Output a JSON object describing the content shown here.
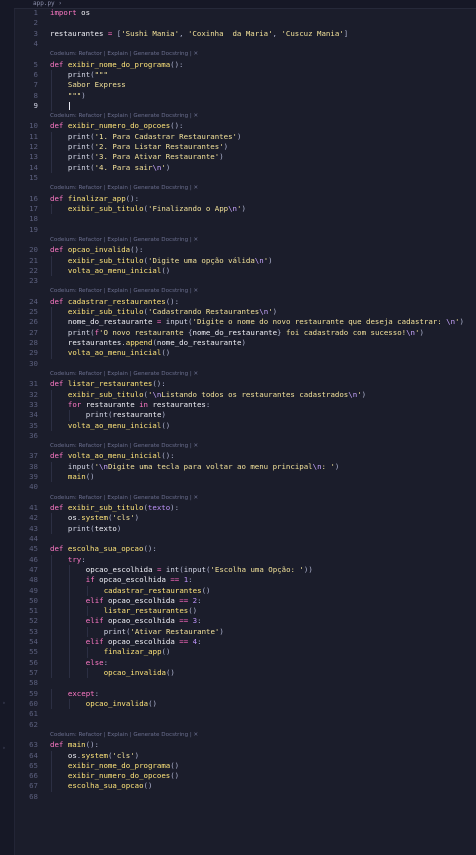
{
  "tab": {
    "filename": "app.py",
    "marker": "›"
  },
  "lens_text": "Codeium: Refactor | Explain | Generate Docstring | ✕",
  "lines": [
    {
      "n": "1",
      "indent": 0,
      "t": [
        [
          "k",
          "import"
        ],
        [
          "p",
          " "
        ],
        [
          "v",
          "os"
        ]
      ]
    },
    {
      "n": "2",
      "indent": 0,
      "t": []
    },
    {
      "n": "3",
      "indent": 0,
      "t": [
        [
          "v",
          "restaurantes"
        ],
        [
          "op",
          " = "
        ],
        [
          "p",
          "["
        ],
        [
          "s",
          "'Sushi Mania'"
        ],
        [
          "p",
          ", "
        ],
        [
          "s",
          "'Coxinha  da Maria'"
        ],
        [
          "p",
          ", "
        ],
        [
          "s",
          "'Cuscuz Mania'"
        ],
        [
          "p",
          "]"
        ]
      ]
    },
    {
      "n": "4",
      "indent": 0,
      "t": []
    },
    {
      "lens": true
    },
    {
      "n": "5",
      "indent": 0,
      "t": [
        [
          "k",
          "def "
        ],
        [
          "f",
          "exibir_nome_do_programa"
        ],
        [
          "p",
          "():"
        ]
      ]
    },
    {
      "n": "6",
      "indent": 1,
      "t": [
        [
          "b",
          "print"
        ],
        [
          "p",
          "("
        ],
        [
          "s",
          "\"\"\""
        ]
      ]
    },
    {
      "n": "7",
      "indent": 1,
      "t": [
        [
          "s",
          "Sabor Express"
        ]
      ]
    },
    {
      "n": "8",
      "indent": 1,
      "t": [
        [
          "s",
          "\"\"\""
        ],
        [
          "p",
          ")"
        ]
      ]
    },
    {
      "n": "9",
      "indent": 1,
      "t": [],
      "active": true,
      "cursor": true
    },
    {
      "lens": true
    },
    {
      "n": "10",
      "indent": 0,
      "t": [
        [
          "k",
          "def "
        ],
        [
          "f",
          "exibir_numero_do_opcoes"
        ],
        [
          "p",
          "():"
        ]
      ]
    },
    {
      "n": "11",
      "indent": 1,
      "t": [
        [
          "b",
          "print"
        ],
        [
          "p",
          "("
        ],
        [
          "s",
          "'1. Para Cadastrar Restaurantes'"
        ],
        [
          "p",
          ")"
        ]
      ]
    },
    {
      "n": "12",
      "indent": 1,
      "t": [
        [
          "b",
          "print"
        ],
        [
          "p",
          "("
        ],
        [
          "s",
          "'2. Para Listar Restaurantes'"
        ],
        [
          "p",
          ")"
        ]
      ]
    },
    {
      "n": "13",
      "indent": 1,
      "t": [
        [
          "b",
          "print"
        ],
        [
          "p",
          "("
        ],
        [
          "s",
          "'3. Para Ativar Restaurante'"
        ],
        [
          "p",
          ")"
        ]
      ]
    },
    {
      "n": "14",
      "indent": 1,
      "t": [
        [
          "b",
          "print"
        ],
        [
          "p",
          "("
        ],
        [
          "s",
          "'4. Para sair"
        ],
        [
          "e",
          "\\n"
        ],
        [
          "s",
          "'"
        ],
        [
          "p",
          ")"
        ]
      ]
    },
    {
      "n": "15",
      "indent": 0,
      "t": []
    },
    {
      "lens": true
    },
    {
      "n": "16",
      "indent": 0,
      "t": [
        [
          "k",
          "def "
        ],
        [
          "f",
          "finalizar_app"
        ],
        [
          "p",
          "():"
        ]
      ]
    },
    {
      "n": "17",
      "indent": 1,
      "t": [
        [
          "f",
          "exibir_sub_titulo"
        ],
        [
          "p",
          "("
        ],
        [
          "s",
          "'Finalizando o App"
        ],
        [
          "e",
          "\\n"
        ],
        [
          "s",
          "'"
        ],
        [
          "p",
          ")"
        ]
      ]
    },
    {
      "n": "18",
      "indent": 0,
      "t": []
    },
    {
      "n": "19",
      "indent": 0,
      "t": []
    },
    {
      "lens": true
    },
    {
      "n": "20",
      "indent": 0,
      "t": [
        [
          "k",
          "def "
        ],
        [
          "f",
          "opcao_invalida"
        ],
        [
          "p",
          "():"
        ]
      ]
    },
    {
      "n": "21",
      "indent": 1,
      "t": [
        [
          "f",
          "exibir_sub_titulo"
        ],
        [
          "p",
          "("
        ],
        [
          "s",
          "'Digite uma opção válida"
        ],
        [
          "e",
          "\\n"
        ],
        [
          "s",
          "'"
        ],
        [
          "p",
          ")"
        ]
      ]
    },
    {
      "n": "22",
      "indent": 1,
      "t": [
        [
          "f",
          "volta_ao_menu_inicial"
        ],
        [
          "p",
          "()"
        ]
      ]
    },
    {
      "n": "23",
      "indent": 0,
      "t": []
    },
    {
      "lens": true
    },
    {
      "n": "24",
      "indent": 0,
      "t": [
        [
          "k",
          "def "
        ],
        [
          "f",
          "cadastrar_restaurantes"
        ],
        [
          "p",
          "():"
        ]
      ]
    },
    {
      "n": "25",
      "indent": 1,
      "t": [
        [
          "f",
          "exibir_sub_titulo"
        ],
        [
          "p",
          "("
        ],
        [
          "s",
          "'Cadastrando Restaurantes"
        ],
        [
          "e",
          "\\n"
        ],
        [
          "s",
          "'"
        ],
        [
          "p",
          ")"
        ]
      ]
    },
    {
      "n": "26",
      "indent": 1,
      "t": [
        [
          "v",
          "nome_do_restaurante"
        ],
        [
          "op",
          " = "
        ],
        [
          "b",
          "input"
        ],
        [
          "p",
          "("
        ],
        [
          "s",
          "'Digite o nome do novo restaurante que deseja cadastrar: "
        ],
        [
          "e",
          "\\n"
        ],
        [
          "s",
          "'"
        ],
        [
          "p",
          ")"
        ]
      ]
    },
    {
      "n": "27",
      "indent": 1,
      "t": [
        [
          "b",
          "print"
        ],
        [
          "p",
          "("
        ],
        [
          "k",
          "f"
        ],
        [
          "s",
          "'O novo restaurante "
        ],
        [
          "p",
          "{"
        ],
        [
          "v",
          "nome_do_restaurante"
        ],
        [
          "p",
          "}"
        ],
        [
          "s",
          " foi cadastrado com sucesso!"
        ],
        [
          "e",
          "\\n"
        ],
        [
          "s",
          "'"
        ],
        [
          "p",
          ")"
        ]
      ]
    },
    {
      "n": "28",
      "indent": 1,
      "t": [
        [
          "v",
          "restaurantes"
        ],
        [
          "p",
          "."
        ],
        [
          "f",
          "append"
        ],
        [
          "p",
          "("
        ],
        [
          "v",
          "nome_do_restaurante"
        ],
        [
          "p",
          ")"
        ]
      ]
    },
    {
      "n": "29",
      "indent": 1,
      "t": [
        [
          "f",
          "volta_ao_menu_inicial"
        ],
        [
          "p",
          "()"
        ]
      ]
    },
    {
      "n": "30",
      "indent": 0,
      "t": []
    },
    {
      "lens": true
    },
    {
      "n": "31",
      "indent": 0,
      "t": [
        [
          "k",
          "def "
        ],
        [
          "f",
          "listar_restaurantes"
        ],
        [
          "p",
          "():"
        ]
      ]
    },
    {
      "n": "32",
      "indent": 1,
      "t": [
        [
          "f",
          "exibir_sub_titulo"
        ],
        [
          "p",
          "("
        ],
        [
          "s",
          "'"
        ],
        [
          "e",
          "\\n"
        ],
        [
          "s",
          "Listando todos os restaurantes cadastrados"
        ],
        [
          "e",
          "\\n"
        ],
        [
          "s",
          "'"
        ],
        [
          "p",
          ")"
        ]
      ]
    },
    {
      "n": "33",
      "indent": 1,
      "t": [
        [
          "k",
          "for "
        ],
        [
          "v",
          "restaurante"
        ],
        [
          "k",
          " in "
        ],
        [
          "v",
          "restaurantes"
        ],
        [
          "p",
          ":"
        ]
      ]
    },
    {
      "n": "34",
      "indent": 2,
      "t": [
        [
          "b",
          "print"
        ],
        [
          "p",
          "("
        ],
        [
          "v",
          "restaurante"
        ],
        [
          "p",
          ")"
        ]
      ]
    },
    {
      "n": "35",
      "indent": 1,
      "t": [
        [
          "f",
          "volta_ao_menu_inicial"
        ],
        [
          "p",
          "()"
        ]
      ]
    },
    {
      "n": "36",
      "indent": 0,
      "t": []
    },
    {
      "lens": true
    },
    {
      "n": "37",
      "indent": 0,
      "t": [
        [
          "k",
          "def "
        ],
        [
          "f",
          "volta_ao_menu_inicial"
        ],
        [
          "p",
          "():"
        ]
      ]
    },
    {
      "n": "38",
      "indent": 1,
      "t": [
        [
          "b",
          "input"
        ],
        [
          "p",
          "("
        ],
        [
          "s",
          "'"
        ],
        [
          "e",
          "\\n"
        ],
        [
          "s",
          "Digite uma tecla para voltar ao menu principal"
        ],
        [
          "e",
          "\\n"
        ],
        [
          "s",
          ": '"
        ],
        [
          "p",
          ")"
        ]
      ]
    },
    {
      "n": "39",
      "indent": 1,
      "t": [
        [
          "f",
          "main"
        ],
        [
          "p",
          "()"
        ]
      ]
    },
    {
      "n": "40",
      "indent": 0,
      "t": []
    },
    {
      "lens": true
    },
    {
      "n": "41",
      "indent": 0,
      "t": [
        [
          "k",
          "def "
        ],
        [
          "f",
          "exibir_sub_titulo"
        ],
        [
          "p",
          "("
        ],
        [
          "n",
          "texto"
        ],
        [
          "p",
          "):"
        ]
      ]
    },
    {
      "n": "42",
      "indent": 1,
      "t": [
        [
          "v",
          "os"
        ],
        [
          "p",
          "."
        ],
        [
          "f",
          "system"
        ],
        [
          "p",
          "("
        ],
        [
          "s",
          "'cls'"
        ],
        [
          "p",
          ")"
        ]
      ]
    },
    {
      "n": "43",
      "indent": 1,
      "t": [
        [
          "b",
          "print"
        ],
        [
          "p",
          "("
        ],
        [
          "v",
          "texto"
        ],
        [
          "p",
          ")"
        ]
      ]
    },
    {
      "n": "44",
      "indent": 0,
      "t": []
    },
    {
      "n": "45",
      "indent": 0,
      "t": [
        [
          "k",
          "def "
        ],
        [
          "f",
          "escolha_sua_opcao"
        ],
        [
          "p",
          "():"
        ]
      ]
    },
    {
      "n": "46",
      "indent": 1,
      "t": [
        [
          "k",
          "try"
        ],
        [
          "p",
          ":"
        ]
      ]
    },
    {
      "n": "47",
      "indent": 2,
      "t": [
        [
          "v",
          "opcao_escolhida"
        ],
        [
          "op",
          " = "
        ],
        [
          "b",
          "int"
        ],
        [
          "p",
          "("
        ],
        [
          "b",
          "input"
        ],
        [
          "p",
          "("
        ],
        [
          "s",
          "'Escolha uma Opção: '"
        ],
        [
          "p",
          "))"
        ]
      ]
    },
    {
      "n": "48",
      "indent": 2,
      "t": [
        [
          "k",
          "if "
        ],
        [
          "v",
          "opcao_escolhida"
        ],
        [
          "op",
          " == "
        ],
        [
          "n",
          "1"
        ],
        [
          "p",
          ":"
        ]
      ]
    },
    {
      "n": "49",
      "indent": 3,
      "t": [
        [
          "f",
          "cadastrar_restaurantes"
        ],
        [
          "p",
          "()"
        ]
      ]
    },
    {
      "n": "50",
      "indent": 2,
      "t": [
        [
          "k",
          "elif "
        ],
        [
          "v",
          "opcao_escolhida"
        ],
        [
          "op",
          " == "
        ],
        [
          "n",
          "2"
        ],
        [
          "p",
          ":"
        ]
      ]
    },
    {
      "n": "51",
      "indent": 3,
      "t": [
        [
          "f",
          "listar_restaurantes"
        ],
        [
          "p",
          "()"
        ]
      ]
    },
    {
      "n": "52",
      "indent": 2,
      "t": [
        [
          "k",
          "elif "
        ],
        [
          "v",
          "opcao_escolhida"
        ],
        [
          "op",
          " == "
        ],
        [
          "n",
          "3"
        ],
        [
          "p",
          ":"
        ]
      ]
    },
    {
      "n": "53",
      "indent": 3,
      "t": [
        [
          "b",
          "print"
        ],
        [
          "p",
          "("
        ],
        [
          "s",
          "'Ativar Restaurante'"
        ],
        [
          "p",
          ")"
        ]
      ]
    },
    {
      "n": "54",
      "indent": 2,
      "t": [
        [
          "k",
          "elif "
        ],
        [
          "v",
          "opcao_escolhida"
        ],
        [
          "op",
          " == "
        ],
        [
          "n",
          "4"
        ],
        [
          "p",
          ":"
        ]
      ]
    },
    {
      "n": "55",
      "indent": 3,
      "t": [
        [
          "f",
          "finalizar_app"
        ],
        [
          "p",
          "()"
        ]
      ]
    },
    {
      "n": "56",
      "indent": 2,
      "t": [
        [
          "k",
          "else"
        ],
        [
          "p",
          ":"
        ]
      ]
    },
    {
      "n": "57",
      "indent": 3,
      "t": [
        [
          "f",
          "opcao_invalida"
        ],
        [
          "p",
          "()"
        ]
      ]
    },
    {
      "n": "58",
      "indent": 0,
      "t": []
    },
    {
      "n": "59",
      "indent": 1,
      "t": [
        [
          "k",
          "except"
        ],
        [
          "p",
          ":"
        ]
      ]
    },
    {
      "n": "60",
      "indent": 2,
      "t": [
        [
          "f",
          "opcao_invalida"
        ],
        [
          "p",
          "()"
        ]
      ]
    },
    {
      "n": "61",
      "indent": 0,
      "t": []
    },
    {
      "n": "62",
      "indent": 0,
      "t": []
    },
    {
      "lens": true
    },
    {
      "n": "63",
      "indent": 0,
      "t": [
        [
          "k",
          "def "
        ],
        [
          "f",
          "main"
        ],
        [
          "p",
          "():"
        ]
      ]
    },
    {
      "n": "64",
      "indent": 1,
      "t": [
        [
          "v",
          "os"
        ],
        [
          "p",
          "."
        ],
        [
          "f",
          "system"
        ],
        [
          "p",
          "("
        ],
        [
          "s",
          "'cls'"
        ],
        [
          "p",
          ")"
        ]
      ]
    },
    {
      "n": "65",
      "indent": 1,
      "t": [
        [
          "f",
          "exibir_nome_do_programa"
        ],
        [
          "p",
          "()"
        ]
      ]
    },
    {
      "n": "66",
      "indent": 1,
      "t": [
        [
          "f",
          "exibir_numero_do_opcoes"
        ],
        [
          "p",
          "()"
        ]
      ]
    },
    {
      "n": "67",
      "indent": 1,
      "t": [
        [
          "f",
          "escolha_sua_opcao"
        ],
        [
          "p",
          "()"
        ]
      ]
    },
    {
      "n": "68",
      "indent": 0,
      "t": []
    }
  ]
}
